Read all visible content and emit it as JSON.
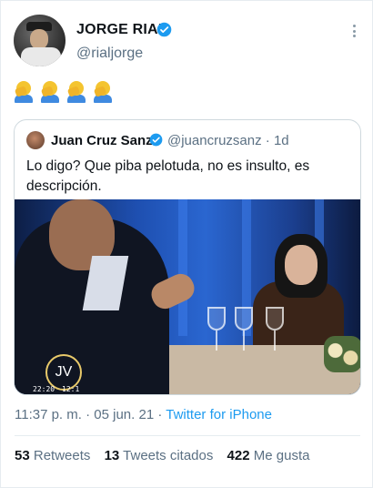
{
  "tweet": {
    "author_name": "JORGE RIAL",
    "author_handle": "@rialjorge",
    "emoji_text": "🤦‍♂️🤦‍♂️🤦‍♂️🤦‍♂️",
    "emoji_icon": "man-facepalming-icon"
  },
  "quoted": {
    "author_name": "Juan Cruz Sanz",
    "author_handle": "@juancruzsanz",
    "separator": "·",
    "age": "1d",
    "text": "Lo digo? Que piba pelotuda, no es insulto, es descripción.",
    "video": {
      "watermark": "JV",
      "time_left": "22:20",
      "time_right": "12:1"
    }
  },
  "meta": {
    "time": "11:37 p. m.",
    "separator": "·",
    "date": "05 jun. 21",
    "source": "Twitter for iPhone"
  },
  "stats": {
    "retweets_count": "53",
    "retweets_label": "Retweets",
    "quotes_count": "13",
    "quotes_label": "Tweets citados",
    "likes_count": "422",
    "likes_label": "Me gusta"
  },
  "colors": {
    "accent": "#1d9bf0",
    "secondary_text": "#5b7083",
    "primary_text": "#0f1419",
    "border": "#cfd9de"
  }
}
